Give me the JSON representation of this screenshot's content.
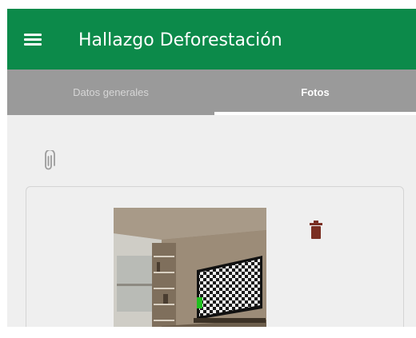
{
  "appbar": {
    "title": "Hallazgo Deforestación",
    "menu_icon": "menu-icon",
    "color": "#0c8a4a"
  },
  "tabs": [
    {
      "label": "Datos generales",
      "selected": false
    },
    {
      "label": "Fotos",
      "selected": true
    }
  ],
  "attachments": {
    "attach_icon": "paperclip-icon"
  },
  "photos": [
    {
      "thumbnail": "room-photo",
      "delete_icon": "trash-icon"
    }
  ],
  "colors": {
    "primary": "#0c8a4a",
    "tab_bar": "#9a9a9a",
    "background": "#efefef",
    "trash": "#7a2f22"
  }
}
